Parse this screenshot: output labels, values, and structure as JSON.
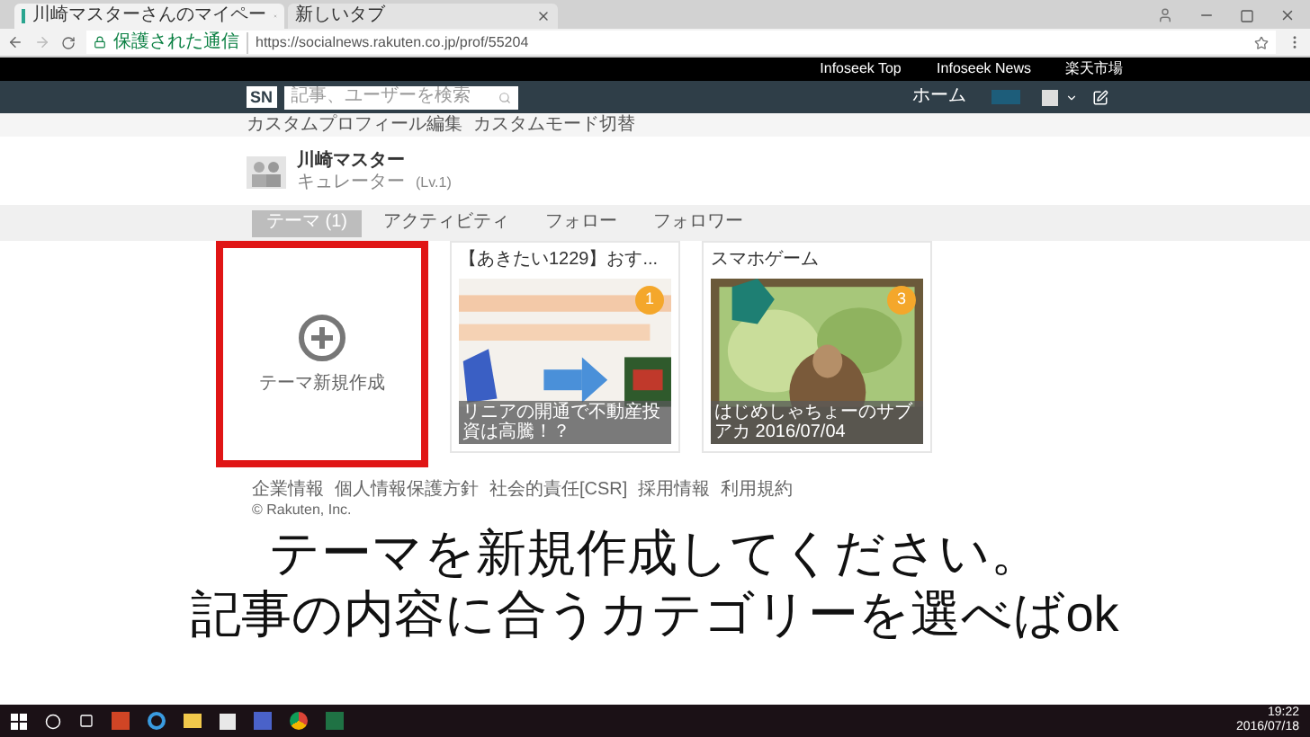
{
  "browser": {
    "tabs": [
      {
        "title": "川崎マスターさんのマイペー",
        "selected": true
      },
      {
        "title": "新しいタブ",
        "selected": false
      }
    ],
    "secure_label": "保護された通信",
    "url": "https://socialnews.rakuten.co.jp/prof/55204"
  },
  "top_links": [
    "Infoseek Top",
    "Infoseek News",
    "楽天市場"
  ],
  "nav": {
    "logo": "SN",
    "search_placeholder": "記事、ユーザーを検索",
    "home": "ホーム"
  },
  "sub_links": [
    "カスタムプロフィール編集",
    "カスタムモード切替"
  ],
  "profile": {
    "name": "川崎マスター",
    "role": "キュレーター",
    "level": "(Lv.1)"
  },
  "profile_tabs": [
    {
      "label": "テーマ (1)",
      "selected": true
    },
    {
      "label": "アクティビティ",
      "selected": false
    },
    {
      "label": "フォロー",
      "selected": false
    },
    {
      "label": "フォロワー",
      "selected": false
    }
  ],
  "cards": [
    {
      "kind": "new",
      "label": "テーマ新規作成",
      "highlighted": true
    },
    {
      "kind": "theme",
      "title": "【あきたい1229】おす...",
      "badge": "1",
      "caption": "リニアの開通で不動産投資は高騰！？",
      "highlighted": false
    },
    {
      "kind": "theme",
      "title": "スマホゲーム",
      "badge": "3",
      "caption": "はじめしゃちょーのサブアカ 2016/07/04",
      "highlighted": false
    }
  ],
  "footer_links": [
    "企業情報",
    "個人情報保護方針",
    "社会的責任[CSR]",
    "採用情報",
    "利用規約"
  ],
  "copyright": "© Rakuten, Inc.",
  "caption_lines": [
    "テーマを新規作成してください。",
    "記事の内容に合うカテゴリーを選べばok"
  ],
  "taskbar": {
    "time": "19:22",
    "date": "2016/07/18"
  }
}
